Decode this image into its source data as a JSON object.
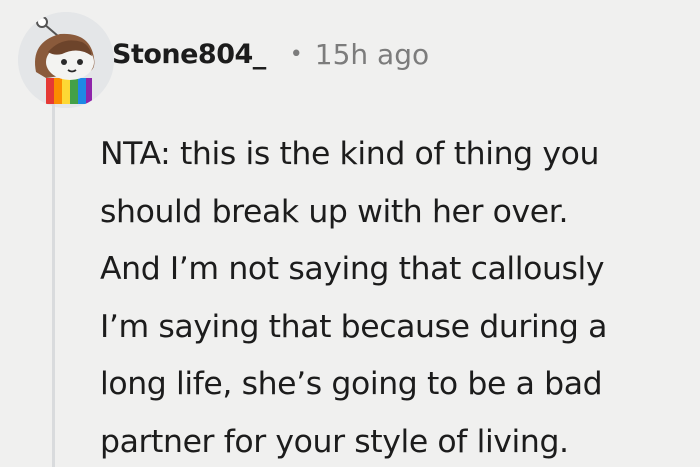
{
  "comment": {
    "author": "Stone804_",
    "separator": "•",
    "timestamp": "15h ago",
    "avatar_icon": "snoo-avatar-icon",
    "body_lines": [
      "NTA: this is the kind of thing you",
      "should break up with her over.",
      "And I’m not saying that callously",
      "I’m saying that because during a",
      "long life, she’s going to be a bad",
      "partner for your style of living."
    ]
  },
  "colors": {
    "background": "#f0f0ef",
    "text": "#1c1c1c",
    "meta": "#7c7c7c",
    "thread_line": "#d9dbdd"
  }
}
